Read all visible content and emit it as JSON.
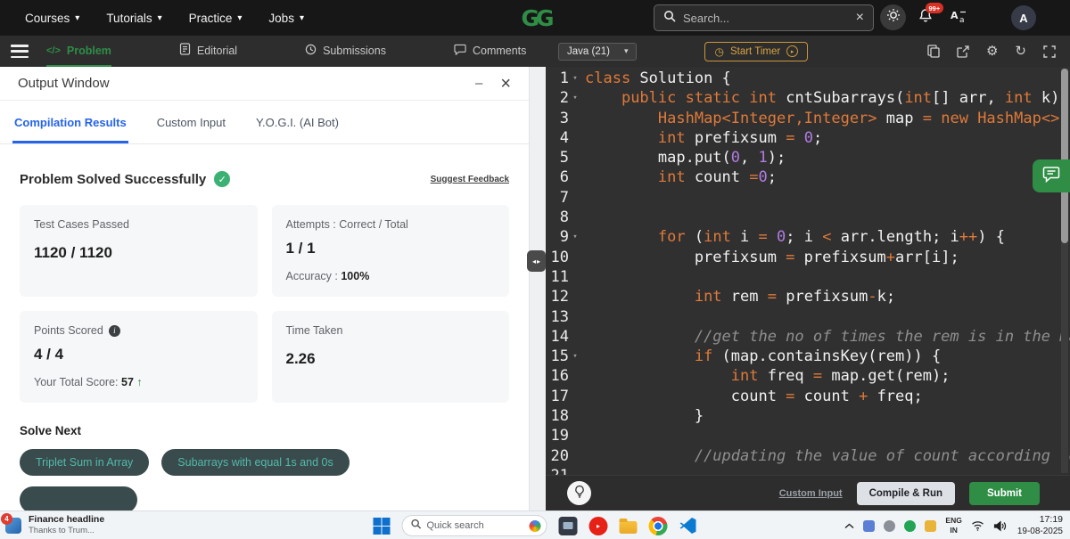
{
  "colors": {
    "gfg_green": "#2f8d46",
    "active_tab_blue": "#2563eb",
    "timer_orange": "#d8a345",
    "keyword_orange": "#df7a3a",
    "number_purple": "#b07ce0",
    "comment_gray": "#8f8f8f",
    "badge_red": "#d93025",
    "submit_green": "#2f8d46"
  },
  "icons": {
    "caret_down": "▾",
    "gear": "⚙",
    "refresh": "↻",
    "stopwatch": "◷",
    "play": "▸",
    "check": "✓",
    "close": "×",
    "minimize": "–",
    "up_arrow": "↑",
    "drag_left": "◂",
    "drag_right": "▸",
    "problem_code": "</>",
    "info": "i"
  },
  "topnav": {
    "menus": [
      "Courses",
      "Tutorials",
      "Practice",
      "Jobs"
    ],
    "search": {
      "placeholder": "Search..."
    },
    "notification_badge": "99+",
    "avatar": "A",
    "logo_text": "GG"
  },
  "toolbar": {
    "problem": "Problem",
    "editorial": "Editorial",
    "submissions": "Submissions",
    "comments": "Comments",
    "language": "Java (21)",
    "start_timer": "Start Timer"
  },
  "output": {
    "title": "Output Window",
    "tab_compilation": "Compilation Results",
    "tab_custom": "Custom Input",
    "tab_yogi": "Y.O.G.I. (AI Bot)",
    "status": "Problem Solved Successfully",
    "feedback": "Suggest Feedback",
    "cards": {
      "test_cases": {
        "label": "Test Cases Passed",
        "value": "1120 / 1120"
      },
      "attempts": {
        "label": "Attempts : Correct / Total",
        "value": "1 / 1",
        "sub_label": "Accuracy :",
        "sub_value": "100%"
      },
      "points": {
        "label": "Points Scored",
        "value": "4 / 4",
        "sub_label": "Your Total Score:",
        "sub_value": "57"
      },
      "time": {
        "label": "Time Taken",
        "value": "2.26"
      }
    },
    "solve_next": {
      "title": "Solve Next",
      "items": [
        "Triplet Sum in Array",
        "Subarrays with equal 1s and 0s"
      ]
    }
  },
  "editor": {
    "footer": {
      "custom_input": "Custom Input",
      "compile": "Compile & Run",
      "submit": "Submit"
    },
    "lines": [
      {
        "n": 1,
        "f": true,
        "t": [
          [
            "k",
            "class"
          ],
          [
            "p",
            " Solution {"
          ]
        ]
      },
      {
        "n": 2,
        "f": true,
        "t": [
          [
            "p",
            "    "
          ],
          [
            "k",
            "public"
          ],
          [
            "p",
            " "
          ],
          [
            "k",
            "static"
          ],
          [
            "p",
            " "
          ],
          [
            "k",
            "int"
          ],
          [
            "p",
            " cntSubarrays("
          ],
          [
            "k",
            "int"
          ],
          [
            "p",
            "[] arr, "
          ],
          [
            "k",
            "int"
          ],
          [
            "p",
            " k) {"
          ]
        ]
      },
      {
        "n": 3,
        "t": [
          [
            "p",
            "        "
          ],
          [
            "k",
            "HashMap<Integer,Integer>"
          ],
          [
            "p",
            " map "
          ],
          [
            "k",
            "="
          ],
          [
            "p",
            " "
          ],
          [
            "k",
            "new"
          ],
          [
            "p",
            " "
          ],
          [
            "k",
            "HashMap<>"
          ],
          [
            "p",
            "();"
          ]
        ]
      },
      {
        "n": 4,
        "t": [
          [
            "p",
            "        "
          ],
          [
            "k",
            "int"
          ],
          [
            "p",
            " prefixsum "
          ],
          [
            "k",
            "="
          ],
          [
            "p",
            " "
          ],
          [
            "n",
            "0"
          ],
          [
            "p",
            ";"
          ]
        ]
      },
      {
        "n": 5,
        "t": [
          [
            "p",
            "        map.put("
          ],
          [
            "n",
            "0"
          ],
          [
            "p",
            ", "
          ],
          [
            "n",
            "1"
          ],
          [
            "p",
            ");"
          ]
        ]
      },
      {
        "n": 6,
        "t": [
          [
            "p",
            "        "
          ],
          [
            "k",
            "int"
          ],
          [
            "p",
            " count "
          ],
          [
            "k",
            "="
          ],
          [
            "n",
            "0"
          ],
          [
            "p",
            ";"
          ]
        ]
      },
      {
        "n": 7,
        "t": []
      },
      {
        "n": 8,
        "t": []
      },
      {
        "n": 9,
        "f": true,
        "t": [
          [
            "p",
            "        "
          ],
          [
            "k",
            "for"
          ],
          [
            "p",
            " ("
          ],
          [
            "k",
            "int"
          ],
          [
            "p",
            " i "
          ],
          [
            "k",
            "="
          ],
          [
            "p",
            " "
          ],
          [
            "n",
            "0"
          ],
          [
            "p",
            "; i "
          ],
          [
            "k",
            "<"
          ],
          [
            "p",
            " arr.length; i"
          ],
          [
            "k",
            "++"
          ],
          [
            "p",
            ") {"
          ]
        ]
      },
      {
        "n": 10,
        "t": [
          [
            "p",
            "            prefixsum "
          ],
          [
            "k",
            "="
          ],
          [
            "p",
            " prefixsum"
          ],
          [
            "k",
            "+"
          ],
          [
            "p",
            "arr[i];"
          ]
        ]
      },
      {
        "n": 11,
        "t": []
      },
      {
        "n": 12,
        "t": [
          [
            "p",
            "            "
          ],
          [
            "k",
            "int"
          ],
          [
            "p",
            " rem "
          ],
          [
            "k",
            "="
          ],
          [
            "p",
            " prefixsum"
          ],
          [
            "k",
            "-"
          ],
          [
            "p",
            "k;"
          ]
        ]
      },
      {
        "n": 13,
        "t": []
      },
      {
        "n": 14,
        "t": [
          [
            "p",
            "            "
          ],
          [
            "c",
            "//get the no of times the rem is in the map"
          ]
        ]
      },
      {
        "n": 15,
        "f": true,
        "t": [
          [
            "p",
            "            "
          ],
          [
            "k",
            "if"
          ],
          [
            "p",
            " (map.containsKey(rem)) {"
          ]
        ]
      },
      {
        "n": 16,
        "t": [
          [
            "p",
            "                "
          ],
          [
            "k",
            "int"
          ],
          [
            "p",
            " freq "
          ],
          [
            "k",
            "="
          ],
          [
            "p",
            " map.get(rem);"
          ]
        ]
      },
      {
        "n": 17,
        "t": [
          [
            "p",
            "                count "
          ],
          [
            "k",
            "="
          ],
          [
            "p",
            " count "
          ],
          [
            "k",
            "+"
          ],
          [
            "p",
            " freq;"
          ]
        ]
      },
      {
        "n": 18,
        "t": [
          [
            "p",
            "            }"
          ]
        ]
      },
      {
        "n": 19,
        "t": []
      },
      {
        "n": 20,
        "t": [
          [
            "p",
            "            "
          ],
          [
            "c",
            "//updating the value of count according to the"
          ]
        ]
      },
      {
        "n": 21,
        "t": []
      }
    ]
  },
  "taskbar": {
    "widget": {
      "badge": "4",
      "title": "Finance headline",
      "subtitle": "Thanks to Trum..."
    },
    "search_placeholder": "Quick search",
    "tray": {
      "lang1": "ENG",
      "lang2": "IN",
      "time": "17:19",
      "date": "19-08-2025"
    }
  }
}
